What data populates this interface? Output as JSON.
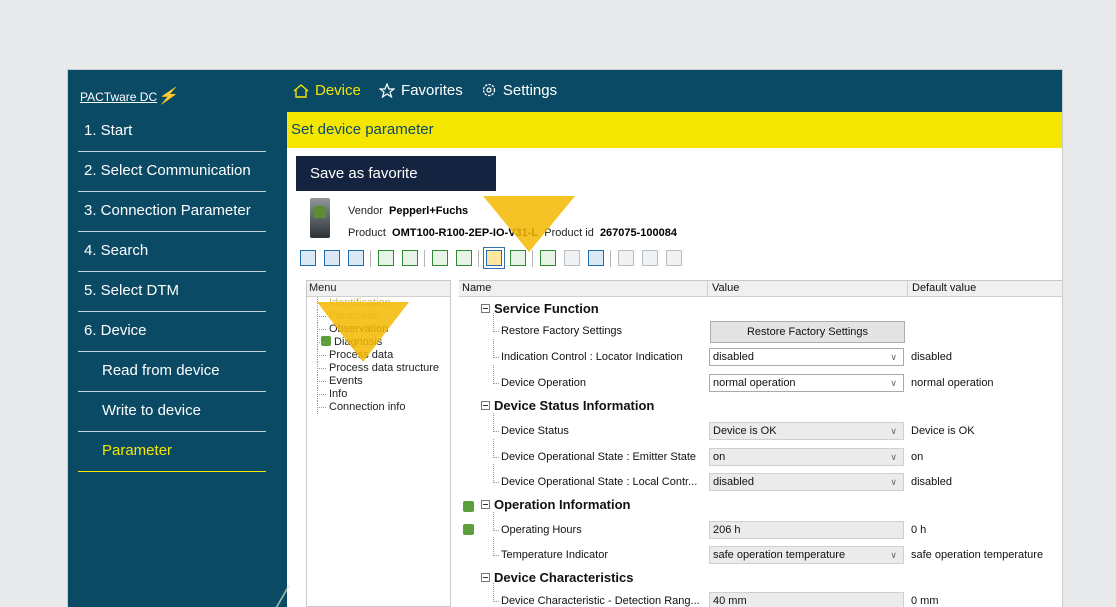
{
  "app": {
    "brand": "PACTware DC"
  },
  "topnav": [
    {
      "label": "Device",
      "icon": "home-icon",
      "active": true
    },
    {
      "label": "Favorites",
      "icon": "star-icon"
    },
    {
      "label": "Settings",
      "icon": "gear-icon"
    }
  ],
  "sidebar": {
    "items": [
      {
        "label": "1. Start"
      },
      {
        "label": "2. Select Communication"
      },
      {
        "label": "3. Connection Parameter"
      },
      {
        "label": "4. Search"
      },
      {
        "label": "5. Select DTM"
      },
      {
        "label": "6. Device"
      },
      {
        "label": "Read from device"
      },
      {
        "label": "Write to device"
      },
      {
        "label": "Parameter"
      }
    ]
  },
  "page": {
    "title": "Set device parameter",
    "save_favorite": "Save as favorite"
  },
  "device": {
    "vendor_label": "Vendor",
    "vendor": "Pepperl+Fuchs",
    "product_label": "Product",
    "product": "OMT100-R100-2EP-IO-V31-L",
    "product_id_label": "Product id",
    "product_id": "267075-100084"
  },
  "menu": {
    "header": "Menu",
    "items": [
      {
        "label": "Identification"
      },
      {
        "label": "Parameter"
      },
      {
        "label": "Observation"
      },
      {
        "label": "Diagnosis"
      },
      {
        "label": "Process data"
      },
      {
        "label": "Process data structure"
      },
      {
        "label": "Events"
      },
      {
        "label": "Info"
      },
      {
        "label": "Connection info"
      }
    ]
  },
  "grid": {
    "headers": {
      "name": "Name",
      "value": "Value",
      "default": "Default value"
    },
    "groups": [
      {
        "title": "Service Function"
      },
      {
        "title": "Device Status Information"
      },
      {
        "title": "Operation Information"
      },
      {
        "title": "Device Characteristics"
      }
    ],
    "rows": [
      {
        "name": "Restore Factory Settings",
        "value": "Restore Factory Settings",
        "default": ""
      },
      {
        "name": "Indication Control : Locator Indication",
        "value": "disabled",
        "default": "disabled"
      },
      {
        "name": "Device Operation",
        "value": "normal operation",
        "default": "normal operation"
      },
      {
        "name": "Device Status",
        "value": "Device is OK",
        "default": "Device is OK"
      },
      {
        "name": "Device Operational State : Emitter State",
        "value": "on",
        "default": "on"
      },
      {
        "name": "Device Operational State : Local Contr...",
        "value": "disabled",
        "default": "disabled"
      },
      {
        "name": "Operating Hours",
        "value": "206 h",
        "default": "0 h"
      },
      {
        "name": "Temperature Indicator",
        "value": "safe operation temperature",
        "default": "safe operation temperature"
      },
      {
        "name": "Device Characteristic - Detection Rang...",
        "value": "40 mm",
        "default": "0 mm"
      }
    ]
  },
  "colors": {
    "brand": "#0b4a64",
    "accent": "#f5e600",
    "highlight": "#f5b800"
  }
}
